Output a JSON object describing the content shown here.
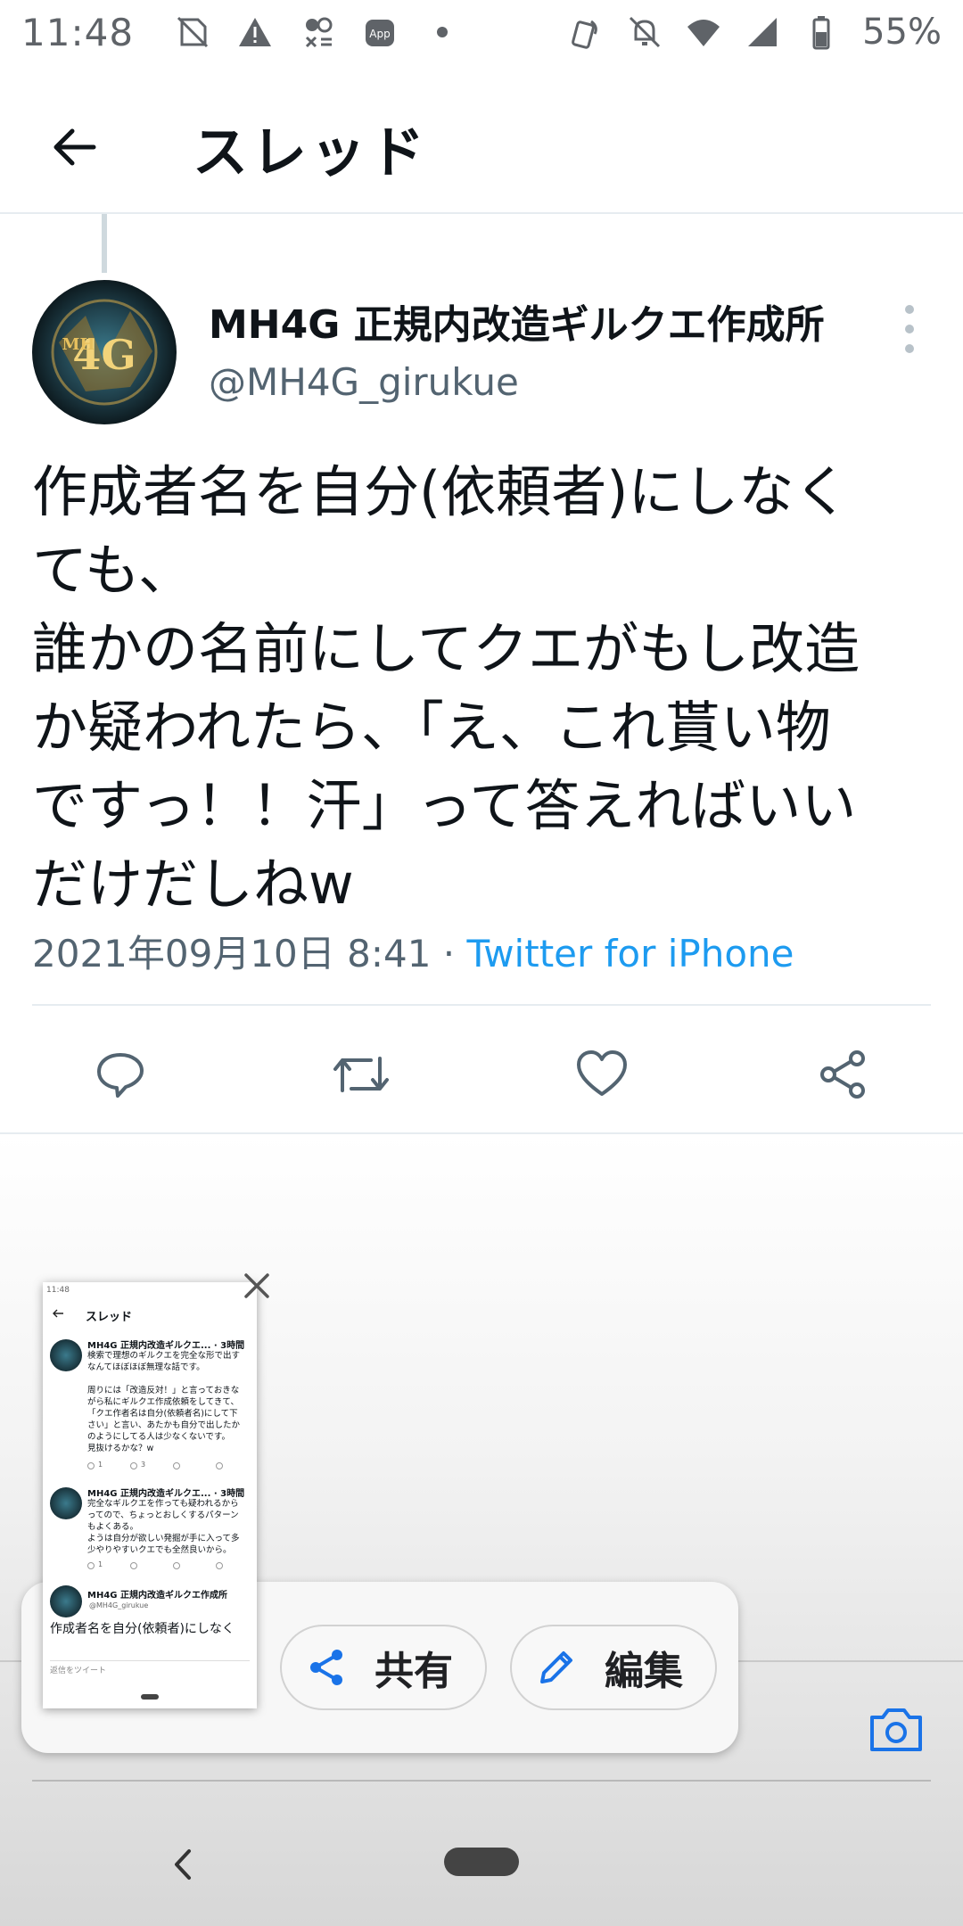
{
  "status_bar": {
    "time": "11:48",
    "battery": "55%",
    "icons_left": [
      "no-sim-icon",
      "warning-icon",
      "bug-icon",
      "app-icon",
      "dot-icon"
    ],
    "icons_right": [
      "nfc-icon",
      "mute-icon",
      "wifi-icon",
      "signal-icon",
      "battery-icon"
    ]
  },
  "header": {
    "title": "スレッド"
  },
  "tweet": {
    "author_name": "MH4G 正規内改造ギルクエ作成所",
    "author_handle": "@MH4G_girukue",
    "text": "作成者名を自分(依頼者)にしなく\nても、\n誰かの名前にしてクエがもし改造\nか疑われたら、「え、これ貰い物\nですっ！！汗」って答えればいい\nだけだしねw",
    "timestamp": "2021年09月10日 8:41 · ",
    "source": "Twitter for iPhone"
  },
  "actions": [
    "reply-icon",
    "retweet-icon",
    "like-icon",
    "share-icon"
  ],
  "screenshot_toolbar": {
    "share_label": "共有",
    "edit_label": "編集"
  },
  "thumbnail": {
    "status": "11:48",
    "title": "スレッド",
    "tweet1_name": "MH4G 正規内改造ギルクエ... · 3時間",
    "tweet1_text": "検索で理想のギルクエを完全な形で出す\nなんてほぼほぼ無理な話です。\n\n周りには「改造反対！」と言っておきな\nがら私にギルクエ作成依頼をしてきて、\n「クエ作者名は自分(依頼者名)にして下\nさい」と言い、あたかも自分で出したか\nのようにしてる人は少なくないです。\n見抜けるかな？w",
    "tweet2_name": "MH4G 正規内改造ギルクエ... · 3時間",
    "tweet2_text": "完全なギルクエを作っても疑われるから\nってので、ちょっとおしくするパターン\nもよくある。\nようは自分が欲しい発掘が手に入って多\n少やりやすいクエでも全然良いから。",
    "tweet3_name": "MH4G 正規内改造ギルクエ作成所",
    "tweet3_handle": "@MH4G_girukue",
    "tweet3_text": "作成者名を自分(依頼者)にしなく",
    "reply_placeholder": "返信をツイート",
    "counts": {
      "reply1": "1",
      "rt1": "3",
      "reply2": "1"
    }
  },
  "colors": {
    "accent": "#1d9bf0",
    "text_primary": "#0f1419",
    "text_secondary": "#536471",
    "icon_gray": "#536471"
  }
}
